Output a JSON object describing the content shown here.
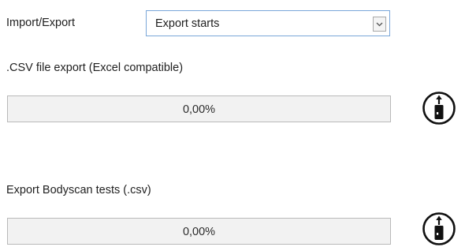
{
  "import_export": {
    "label": "Import/Export",
    "selected": "Export starts"
  },
  "csv_export": {
    "label": ".CSV file export (Excel compatible)",
    "progress_text": "0,00%",
    "progress_value": 0,
    "icon": "usb-upload-icon"
  },
  "bodyscan_export": {
    "label": "Export Bodyscan tests (.csv)",
    "progress_text": "0,00%",
    "progress_value": 0,
    "icon": "usb-upload-icon"
  }
}
